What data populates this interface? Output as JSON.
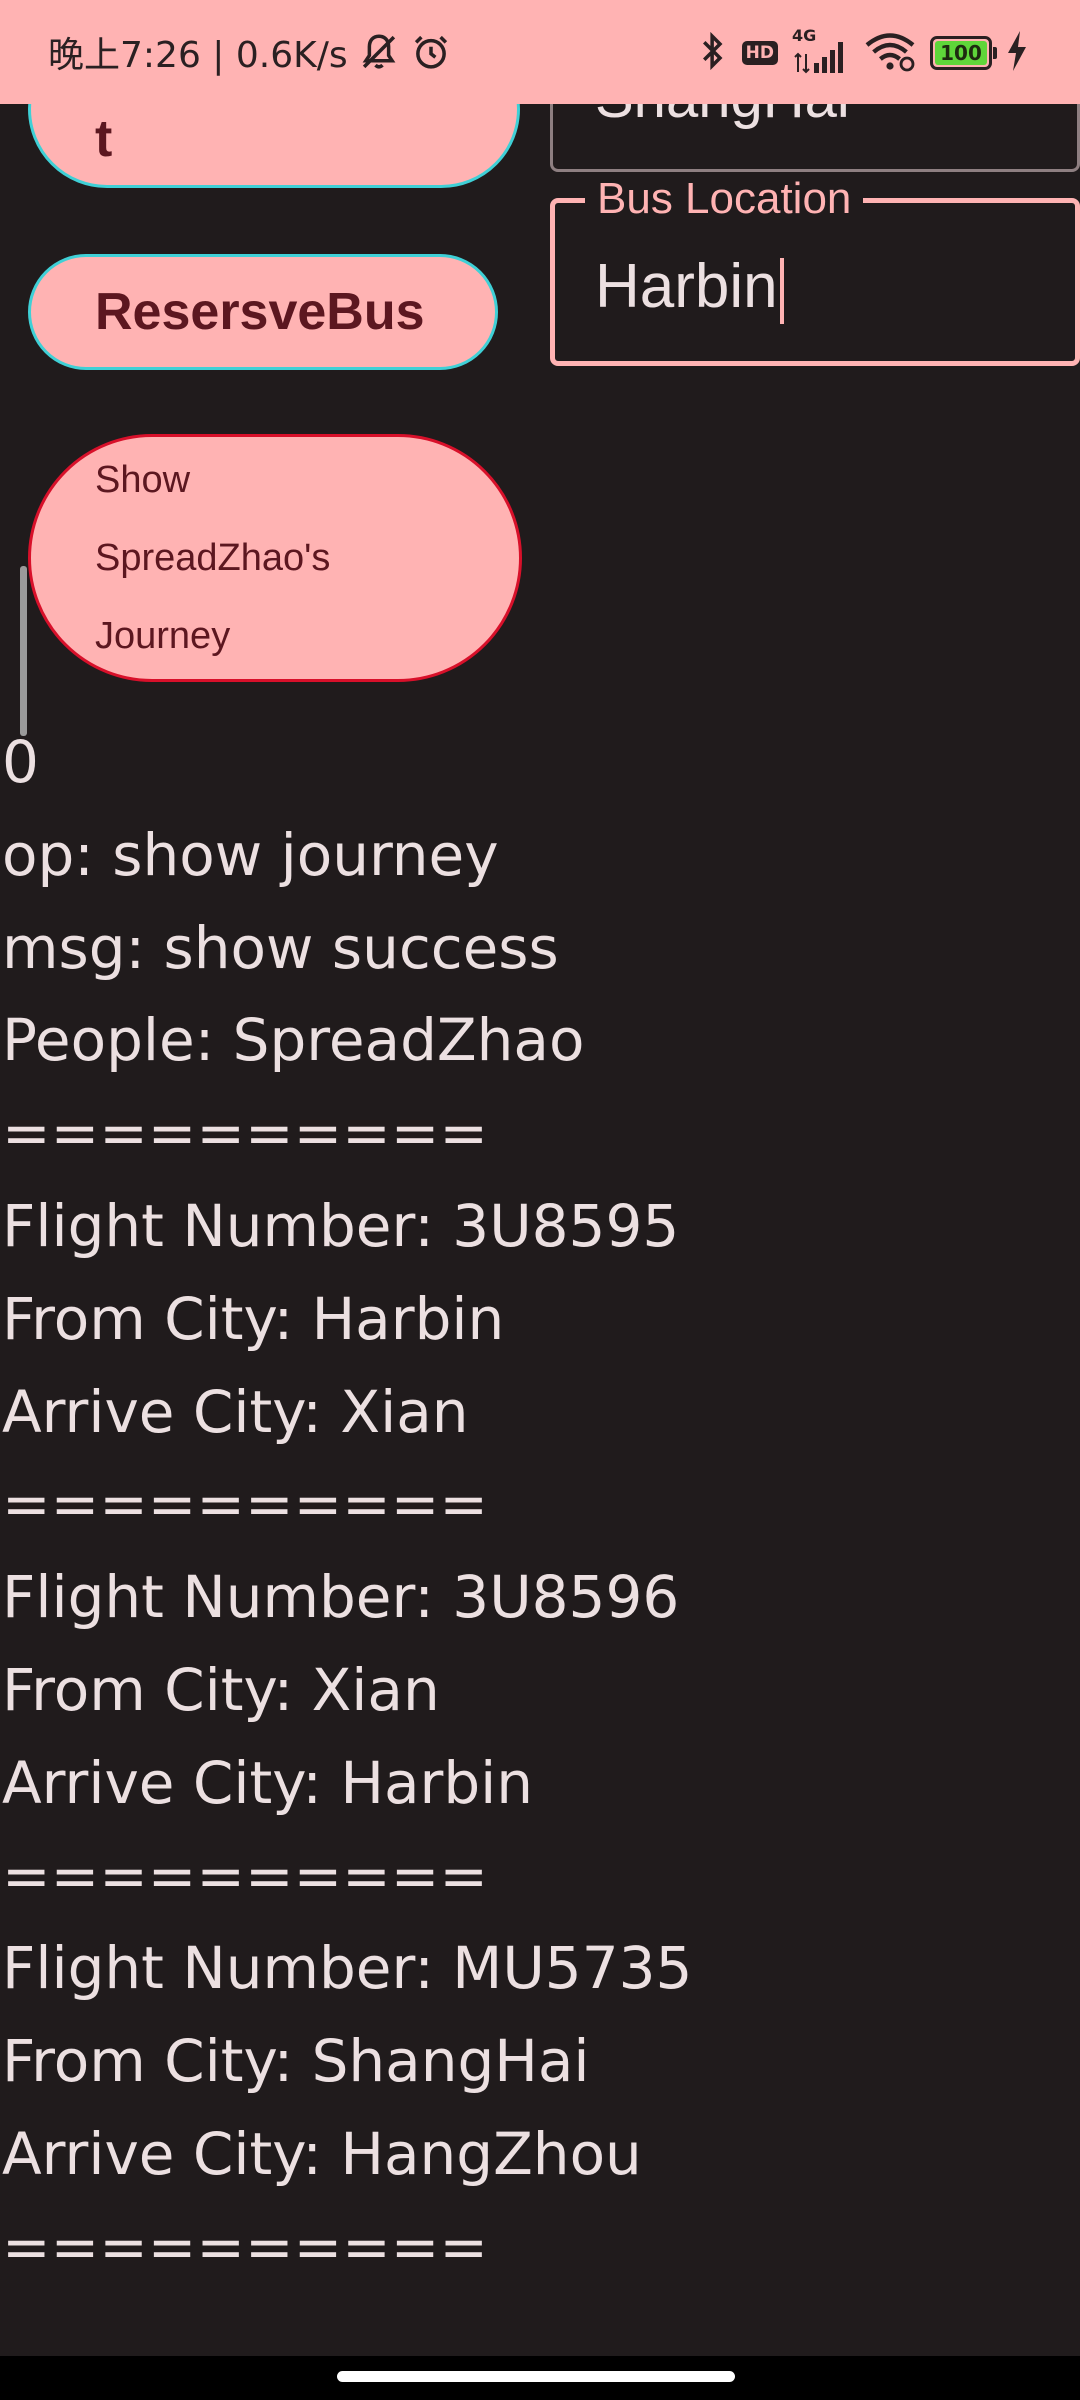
{
  "status_bar": {
    "time_text": "晚上7:26 | 0.6K/s",
    "network_label": "4G",
    "hd_label": "HD",
    "battery_level": "100",
    "battery_fraction": 1.0,
    "battery_color": "#5fd63a"
  },
  "buttons": {
    "partial_label": "t",
    "reserve_bus_label": "ResersveBus",
    "show_journey_label": "Show SpreadZhao's Journey"
  },
  "fields": {
    "city_value": "ShangHai",
    "bus_location_label": "Bus Location",
    "bus_location_value": "Harbin"
  },
  "output_lines": [
    "0",
    "op: show journey",
    "msg: show success",
    "People: SpreadZhao",
    "==========",
    "Flight Number: 3U8595",
    "From City: Harbin",
    "Arrive City: Xian",
    "==========",
    "Flight Number: 3U8596",
    "From City: Xian",
    "Arrive City: Harbin",
    "==========",
    "Flight Number: MU5735",
    "From City: ShangHai",
    "Arrive City: HangZhou",
    "=========="
  ],
  "colors": {
    "background": "#201b1c",
    "accent_pink": "#ffb3b3",
    "button_text": "#5c1720",
    "cyan_border": "#3fd0d6",
    "red_border": "#d8102a",
    "text_light": "#ece0e1"
  },
  "icons": {
    "mute": "bell-off-icon",
    "alarm": "alarm-clock-icon",
    "bluetooth": "bluetooth-icon",
    "signal": "cellular-signal-icon",
    "wifi": "wifi-icon",
    "charging": "charging-bolt-icon"
  }
}
